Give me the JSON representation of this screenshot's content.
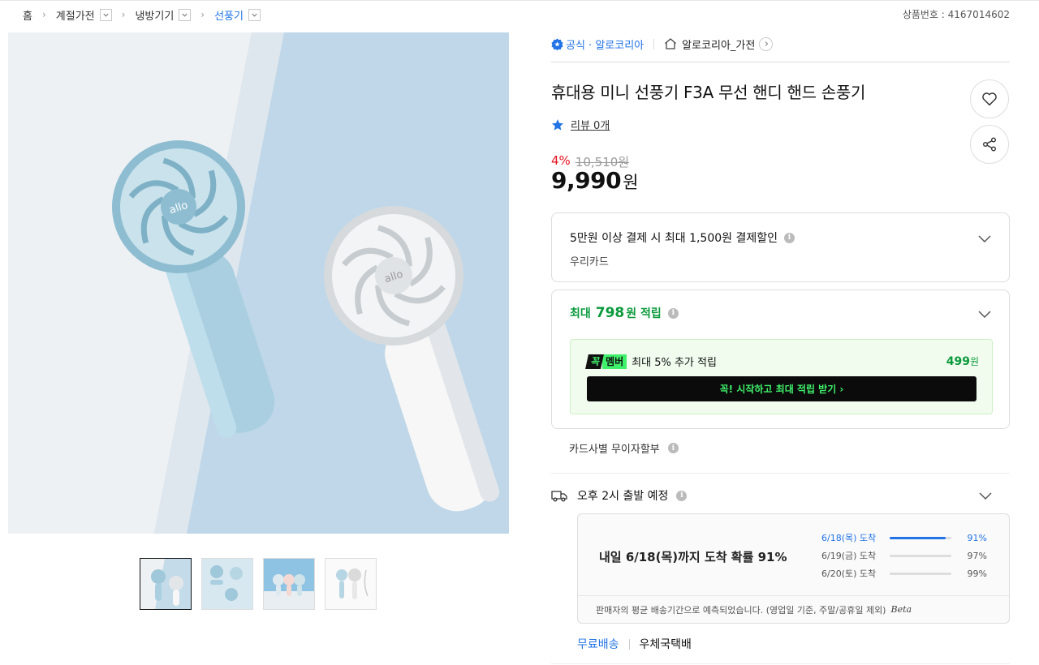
{
  "breadcrumb": {
    "items": [
      {
        "label": "홈"
      },
      {
        "label": "계절가전"
      },
      {
        "label": "냉방기기"
      },
      {
        "label": "선풍기"
      }
    ]
  },
  "product_number": "상품번호 : 4167014602",
  "seller": {
    "official_label": "공식 · 알로코리아",
    "store_name": "알로코리아_가전"
  },
  "product": {
    "title": "휴대용 미니 선풍기 F3A 무선 핸디 핸드 손풍기",
    "review_text": "리뷰 0개",
    "discount_rate": "4%",
    "original_price": "10,510원",
    "price": "9,990",
    "price_unit": "원"
  },
  "card_discount": {
    "line1": "5만원 이상 결제 시 최대 1,500원 결제할인",
    "line2": "우리카드"
  },
  "points": {
    "prefix": "최대",
    "amount": "798",
    "suffix": "원 적립",
    "member_badge_left": "꼭",
    "member_badge_right": "멤버",
    "member_text": "최대 5% 추가 적립",
    "member_points": "499",
    "member_points_unit": "원",
    "cta_label": "꼭! 시작하고 최대 적립 받기  ›"
  },
  "installment_label": "카드사별 무이자할부",
  "shipping": {
    "departure": "오후 2시 출발 예정",
    "arrival_summary": "내일 6/18(목)까지 도착 확률 91%",
    "distribution": [
      {
        "label": "6/18(목) 도착",
        "pct": "91%",
        "value": 91,
        "highlight": true
      },
      {
        "label": "6/19(금) 도착",
        "pct": "97%",
        "value": 97,
        "highlight": false
      },
      {
        "label": "6/20(토) 도착",
        "pct": "99%",
        "value": 99,
        "highlight": false
      }
    ],
    "note": "판매자의 평균 배송기간으로 예측되었습니다. (영업일 기준, 주말/공휴일 제외)",
    "beta_label": "Beta",
    "free_label": "무료배송",
    "carrier": "우체국택배"
  },
  "colors": {
    "accent_blue": "#2173e6",
    "discount_red": "#e5111f",
    "points_green": "#0a9a3c",
    "member_neon": "#3ff06a"
  },
  "icons": [
    "chevron-down-icon",
    "official-badge-icon",
    "store-icon",
    "arrow-right-icon",
    "heart-icon",
    "share-icon",
    "star-icon",
    "info-icon",
    "truck-icon"
  ]
}
